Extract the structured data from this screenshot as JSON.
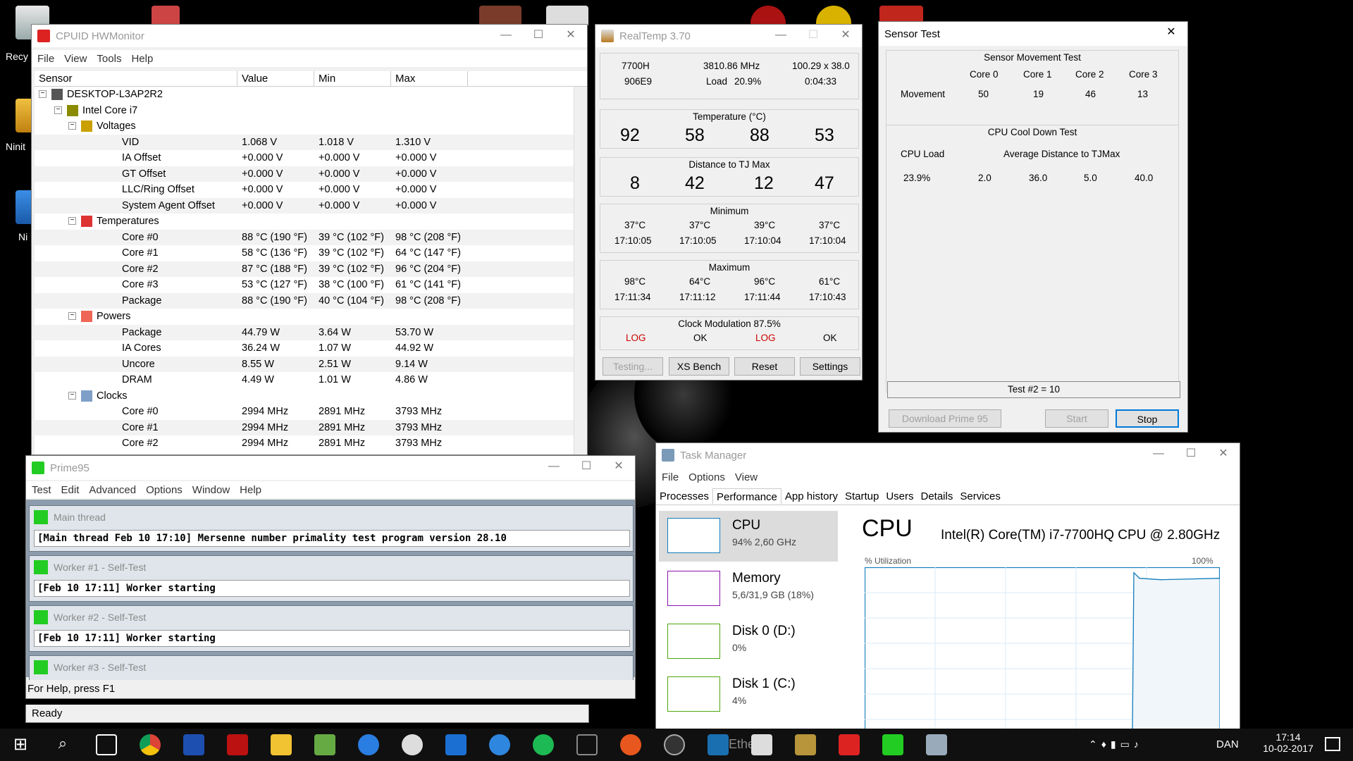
{
  "desktop": {
    "icons": [
      {
        "label": "Recy"
      },
      {
        "label": "Ninit"
      },
      {
        "label": "Ni"
      }
    ]
  },
  "hwmonitor": {
    "title": "CPUID HWMonitor",
    "menu": [
      "File",
      "View",
      "Tools",
      "Help"
    ],
    "columns": [
      "Sensor",
      "Value",
      "Min",
      "Max"
    ],
    "rows": [
      {
        "label": "DESKTOP-L3AP2R2",
        "level": 0,
        "value": "",
        "min": "",
        "max": "",
        "icon": "computer-icon"
      },
      {
        "label": "Intel Core i7",
        "level": 1,
        "value": "",
        "min": "",
        "max": "",
        "icon": "chip-icon"
      },
      {
        "label": "Voltages",
        "level": 2,
        "value": "",
        "min": "",
        "max": "",
        "icon": "voltage-icon"
      },
      {
        "label": "VID",
        "level": 3,
        "value": "1.068 V",
        "min": "1.018 V",
        "max": "1.310 V"
      },
      {
        "label": "IA Offset",
        "level": 3,
        "value": "+0.000 V",
        "min": "+0.000 V",
        "max": "+0.000 V"
      },
      {
        "label": "GT Offset",
        "level": 3,
        "value": "+0.000 V",
        "min": "+0.000 V",
        "max": "+0.000 V"
      },
      {
        "label": "LLC/Ring Offset",
        "level": 3,
        "value": "+0.000 V",
        "min": "+0.000 V",
        "max": "+0.000 V"
      },
      {
        "label": "System Agent Offset",
        "level": 3,
        "value": "+0.000 V",
        "min": "+0.000 V",
        "max": "+0.000 V"
      },
      {
        "label": "Temperatures",
        "level": 2,
        "value": "",
        "min": "",
        "max": "",
        "icon": "thermometer-icon"
      },
      {
        "label": "Core #0",
        "level": 3,
        "value": "88 °C  (190 °F)",
        "min": "39 °C  (102 °F)",
        "max": "98 °C  (208 °F)"
      },
      {
        "label": "Core #1",
        "level": 3,
        "value": "58 °C  (136 °F)",
        "min": "39 °C  (102 °F)",
        "max": "64 °C  (147 °F)"
      },
      {
        "label": "Core #2",
        "level": 3,
        "value": "87 °C  (188 °F)",
        "min": "39 °C  (102 °F)",
        "max": "96 °C  (204 °F)"
      },
      {
        "label": "Core #3",
        "level": 3,
        "value": "53 °C  (127 °F)",
        "min": "38 °C  (100 °F)",
        "max": "61 °C  (141 °F)"
      },
      {
        "label": "Package",
        "level": 3,
        "value": "88 °C  (190 °F)",
        "min": "40 °C  (104 °F)",
        "max": "98 °C  (208 °F)"
      },
      {
        "label": "Powers",
        "level": 2,
        "value": "",
        "min": "",
        "max": "",
        "icon": "fire-icon"
      },
      {
        "label": "Package",
        "level": 3,
        "value": "44.79 W",
        "min": "3.64 W",
        "max": "53.70 W"
      },
      {
        "label": "IA Cores",
        "level": 3,
        "value": "36.24 W",
        "min": "1.07 W",
        "max": "44.92 W"
      },
      {
        "label": "Uncore",
        "level": 3,
        "value": "8.55 W",
        "min": "2.51 W",
        "max": "9.14 W"
      },
      {
        "label": "DRAM",
        "level": 3,
        "value": "4.49 W",
        "min": "1.01 W",
        "max": "4.86 W"
      },
      {
        "label": "Clocks",
        "level": 2,
        "value": "",
        "min": "",
        "max": "",
        "icon": "clock-icon"
      },
      {
        "label": "Core #0",
        "level": 3,
        "value": "2994 MHz",
        "min": "2891 MHz",
        "max": "3793 MHz"
      },
      {
        "label": "Core #1",
        "level": 3,
        "value": "2994 MHz",
        "min": "2891 MHz",
        "max": "3793 MHz"
      },
      {
        "label": "Core #2",
        "level": 3,
        "value": "2994 MHz",
        "min": "2891 MHz",
        "max": "3793 MHz"
      }
    ],
    "status": "Ready"
  },
  "realtemp": {
    "title": "RealTemp 3.70",
    "info": {
      "cpu": "7700H",
      "freq": "3810.86 MHz",
      "mult": "100.29 x 38.0",
      "id": "906E9",
      "load_label": "Load",
      "load": "20.9%",
      "time": "0:04:33"
    },
    "temp_label": "Temperature (°C)",
    "temps": [
      "92",
      "58",
      "88",
      "53"
    ],
    "dist_label": "Distance to TJ Max",
    "dists": [
      "8",
      "42",
      "12",
      "47"
    ],
    "min_label": "Minimum",
    "min_t": [
      "37°C",
      "37°C",
      "39°C",
      "37°C"
    ],
    "min_time": [
      "17:10:05",
      "17:10:05",
      "17:10:04",
      "17:10:04"
    ],
    "max_label": "Maximum",
    "max_t": [
      "98°C",
      "64°C",
      "96°C",
      "61°C"
    ],
    "max_time": [
      "17:11:34",
      "17:11:12",
      "17:11:44",
      "17:10:43"
    ],
    "clock_mod": "Clock Modulation  87.5%",
    "mod_status": [
      "LOG",
      "OK",
      "LOG",
      "OK"
    ],
    "buttons": [
      "Testing...",
      "XS Bench",
      "Reset",
      "Settings"
    ]
  },
  "sensortest": {
    "title": "Sensor Test",
    "movement_title": "Sensor Movement Test",
    "cores": [
      "Core 0",
      "Core 1",
      "Core 2",
      "Core 3"
    ],
    "movement_label": "Movement",
    "movement": [
      "50",
      "19",
      "46",
      "13"
    ],
    "cooldown_title": "CPU Cool Down Test",
    "cpu_load_label": "CPU Load",
    "avg_label": "Average Distance to TJMax",
    "cpu_load": "23.9%",
    "avg": [
      "2.0",
      "36.0",
      "5.0",
      "40.0"
    ],
    "test_result": "Test #2 = 10",
    "buttons": [
      "Download Prime 95",
      "Start",
      "Stop"
    ]
  },
  "prime95": {
    "title": "Prime95",
    "menu": [
      "Test",
      "Edit",
      "Advanced",
      "Options",
      "Window",
      "Help"
    ],
    "threads": [
      {
        "title": "Main thread",
        "text": "[Main thread Feb 10 17:10] Mersenne number primality test program version 28.10"
      },
      {
        "title": "Worker #1 - Self-Test",
        "text": "[Feb 10 17:11] Worker starting"
      },
      {
        "title": "Worker #2 - Self-Test",
        "text": "[Feb 10 17:11] Worker starting"
      },
      {
        "title": "Worker #3 - Self-Test",
        "text": ""
      }
    ],
    "status": "For Help, press F1"
  },
  "taskmgr": {
    "title": "Task Manager",
    "menu": [
      "File",
      "Options",
      "View"
    ],
    "tabs": [
      "Processes",
      "Performance",
      "App history",
      "Startup",
      "Users",
      "Details",
      "Services"
    ],
    "active_tab": "Performance",
    "resources": [
      {
        "name": "CPU",
        "detail": "94%  2,60 GHz",
        "color": "#117dbb"
      },
      {
        "name": "Memory",
        "detail": "5,6/31,9 GB (18%)",
        "color": "#8b12ae"
      },
      {
        "name": "Disk 0 (D:)",
        "detail": "0%",
        "color": "#4da60c"
      },
      {
        "name": "Disk 1 (C:)",
        "detail": "4%",
        "color": "#4da60c"
      }
    ],
    "heading": "CPU",
    "cpu_name": "Intel(R) Core(TM) i7-7700HQ CPU @ 2.80GHz",
    "util_label": "% Utilization",
    "util_max": "100%",
    "util_level": 0.95
  },
  "taskbar": {
    "time": "17:14",
    "date": "10-02-2017",
    "lang": "DAN",
    "partial_label": "Ethe"
  }
}
